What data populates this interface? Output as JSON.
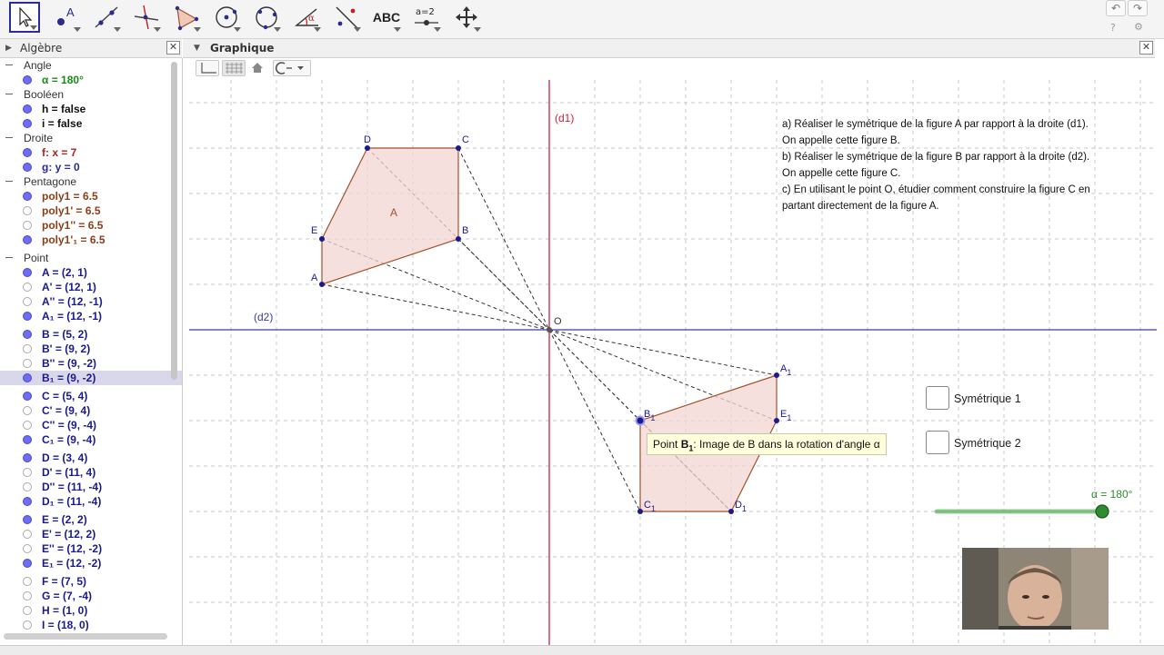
{
  "toolbar": {
    "tools": [
      {
        "name": "move-tool",
        "icon": "arrow-pointer-icon"
      },
      {
        "name": "point-tool",
        "icon": "point-icon",
        "label": "A"
      },
      {
        "name": "line-tool",
        "icon": "line-icon"
      },
      {
        "name": "perpendicular-tool",
        "icon": "perpendicular-line-icon"
      },
      {
        "name": "polygon-tool",
        "icon": "polygon-icon"
      },
      {
        "name": "circle-tool",
        "icon": "circle-center-icon"
      },
      {
        "name": "circle-3points-tool",
        "icon": "circle-three-points-icon"
      },
      {
        "name": "angle-tool",
        "icon": "angle-icon",
        "label": "α"
      },
      {
        "name": "reflect-tool",
        "icon": "reflect-line-icon"
      },
      {
        "name": "text-tool",
        "icon": "text-icon",
        "label": "ABC"
      },
      {
        "name": "slider-tool",
        "icon": "slider-icon",
        "label": "a=2"
      },
      {
        "name": "move-graphics-tool",
        "icon": "move-view-icon"
      }
    ],
    "undo_icon": "↶",
    "redo_icon": "↷",
    "help_icon": "?",
    "settings_icon": "⚙"
  },
  "algebra": {
    "title": "Algèbre",
    "rows": [
      {
        "type": "cat",
        "text": "Angle"
      },
      {
        "type": "item",
        "text": "α = 180°",
        "color": "#1a8a1a",
        "dot": "on"
      },
      {
        "type": "cat",
        "text": "Booléen"
      },
      {
        "type": "item",
        "text": "h = false",
        "color": "#111111",
        "dot": "on"
      },
      {
        "type": "item",
        "text": "i = false",
        "color": "#111111",
        "dot": "on"
      },
      {
        "type": "cat",
        "text": "Droite"
      },
      {
        "type": "item",
        "text": "f: x = 7",
        "color": "#b02020",
        "dot": "on"
      },
      {
        "type": "item",
        "text": "g: y = 0",
        "color": "#2a2a90",
        "dot": "on"
      },
      {
        "type": "cat",
        "text": "Pentagone"
      },
      {
        "type": "item",
        "text": "poly1 = 6.5",
        "color": "#8a3e1a",
        "dot": "on"
      },
      {
        "type": "item",
        "text": "poly1' = 6.5",
        "color": "#8a3e1a",
        "dot": "off"
      },
      {
        "type": "item",
        "text": "poly1'' = 6.5",
        "color": "#8a3e1a",
        "dot": "off"
      },
      {
        "type": "item",
        "text": "poly1'₁ = 6.5",
        "color": "#8a3e1a",
        "dot": "on"
      },
      {
        "type": "cat",
        "text": "Point"
      },
      {
        "type": "item",
        "text": "A = (2, 1)",
        "color": "#1a1a8c",
        "dot": "on"
      },
      {
        "type": "item",
        "text": "A' = (12, 1)",
        "color": "#1a1a8c",
        "dot": "off"
      },
      {
        "type": "item",
        "text": "A'' = (12, -1)",
        "color": "#1a1a8c",
        "dot": "off"
      },
      {
        "type": "item",
        "text": "A₁ = (12, -1)",
        "color": "#1a1a8c",
        "dot": "on"
      },
      {
        "type": "item",
        "text": "B = (5, 2)",
        "color": "#1a1a8c",
        "dot": "on"
      },
      {
        "type": "item",
        "text": "B' = (9, 2)",
        "color": "#1a1a8c",
        "dot": "off"
      },
      {
        "type": "item",
        "text": "B'' = (9, -2)",
        "color": "#1a1a8c",
        "dot": "off"
      },
      {
        "type": "item",
        "text": "B₁ = (9, -2)",
        "color": "#1a1a8c",
        "dot": "on",
        "selected": true
      },
      {
        "type": "item",
        "text": "C = (5, 4)",
        "color": "#1a1a8c",
        "dot": "on"
      },
      {
        "type": "item",
        "text": "C' = (9, 4)",
        "color": "#1a1a8c",
        "dot": "off"
      },
      {
        "type": "item",
        "text": "C'' = (9, -4)",
        "color": "#1a1a8c",
        "dot": "off"
      },
      {
        "type": "item",
        "text": "C₁ = (9, -4)",
        "color": "#1a1a8c",
        "dot": "on"
      },
      {
        "type": "item",
        "text": "D = (3, 4)",
        "color": "#1a1a8c",
        "dot": "on"
      },
      {
        "type": "item",
        "text": "D' = (11, 4)",
        "color": "#1a1a8c",
        "dot": "off"
      },
      {
        "type": "item",
        "text": "D'' = (11, -4)",
        "color": "#1a1a8c",
        "dot": "off"
      },
      {
        "type": "item",
        "text": "D₁ = (11, -4)",
        "color": "#1a1a8c",
        "dot": "on"
      },
      {
        "type": "item",
        "text": "E = (2, 2)",
        "color": "#1a1a8c",
        "dot": "on"
      },
      {
        "type": "item",
        "text": "E' = (12, 2)",
        "color": "#1a1a8c",
        "dot": "off"
      },
      {
        "type": "item",
        "text": "E'' = (12, -2)",
        "color": "#1a1a8c",
        "dot": "off"
      },
      {
        "type": "item",
        "text": "E₁ = (12, -2)",
        "color": "#1a1a8c",
        "dot": "on"
      },
      {
        "type": "item",
        "text": "F = (7, 5)",
        "color": "#1a1a8c",
        "dot": "off"
      },
      {
        "type": "item",
        "text": "G = (7, -4)",
        "color": "#1a1a8c",
        "dot": "off"
      },
      {
        "type": "item",
        "text": "H = (1, 0)",
        "color": "#1a1a8c",
        "dot": "off"
      },
      {
        "type": "item",
        "text": "I = (18, 0)",
        "color": "#1a1a8c",
        "dot": "off"
      }
    ]
  },
  "graphics": {
    "title": "Graphique",
    "line_d1_label": "(d1)",
    "line_d2_label": "(d2)",
    "origin_label": "O",
    "polygon_label": "A",
    "points": {
      "A": {
        "label": "A",
        "sub": ""
      },
      "B": {
        "label": "B",
        "sub": ""
      },
      "C": {
        "label": "C",
        "sub": ""
      },
      "D": {
        "label": "D",
        "sub": ""
      },
      "E": {
        "label": "E",
        "sub": ""
      },
      "A1": {
        "label": "A",
        "sub": "1"
      },
      "B1": {
        "label": "B",
        "sub": "1"
      },
      "C1": {
        "label": "C",
        "sub": "1"
      },
      "D1": {
        "label": "D",
        "sub": "1"
      },
      "E1": {
        "label": "E",
        "sub": "1"
      }
    },
    "instructions": [
      "a) Réaliser le symétrique de la figure A par rapport à la droite (d1).",
      "On appelle cette figure B.",
      "b) Réaliser le symétrique de la figure B par rapport à la droite (d2).",
      "On appelle cette figure C.",
      "c) En utilisant le point O, étudier comment construire la figure C en",
      "partant directement de la figure A."
    ],
    "checkbox1": "Symétrique 1",
    "checkbox2": "Symétrique 2",
    "slider_label": "α = 180°",
    "slider_value": 1.0,
    "tooltip_prefix": "Point ",
    "tooltip_point": "B",
    "tooltip_sub": "1",
    "tooltip_suffix": ": Image de B dans la rotation d'angle α",
    "colors": {
      "polygon_fill": "#f3d6d3",
      "polygon_stroke": "#a0522d",
      "d1": "#cc2040",
      "d2": "#3a3ab0",
      "point": "#1a1a8c",
      "slider": "#2e8b2e"
    }
  }
}
